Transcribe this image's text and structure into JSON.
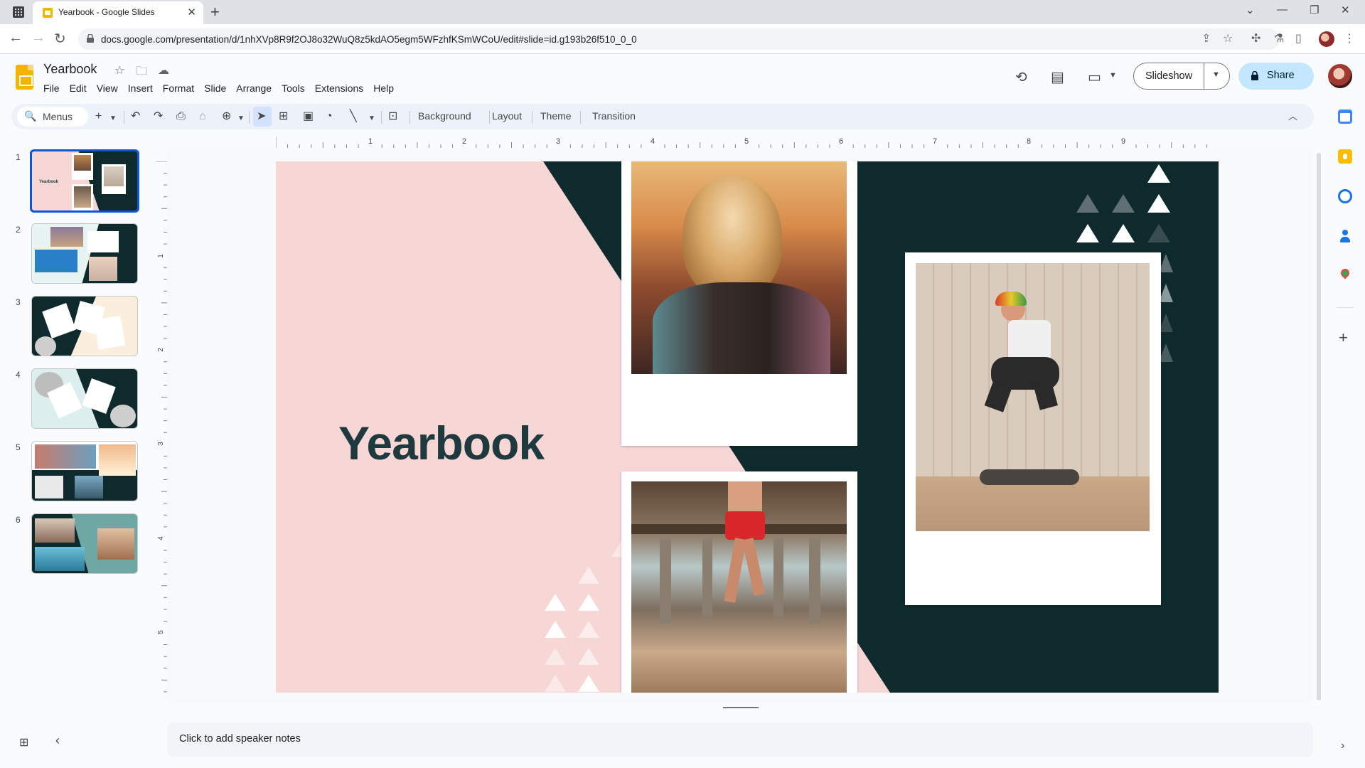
{
  "browser": {
    "tab_title": "Yearbook - Google Slides",
    "url": "docs.google.com/presentation/d/1nhXVp8R9f2OJ8o32WuQ8z5kdAO5egm5WFzhfKSmWCoU/edit#slide=id.g193b26f510_0_0"
  },
  "doc": {
    "title": "Yearbook",
    "menus": [
      "File",
      "Edit",
      "View",
      "Insert",
      "Format",
      "Slide",
      "Arrange",
      "Tools",
      "Extensions",
      "Help"
    ]
  },
  "header": {
    "slideshow_label": "Slideshow",
    "share_label": "Share"
  },
  "toolbar": {
    "search_label": "Menus",
    "background": "Background",
    "layout": "Layout",
    "theme": "Theme",
    "transition": "Transition"
  },
  "filmstrip": {
    "slides": [
      {
        "num": "1",
        "label": "Yearbook"
      },
      {
        "num": "2"
      },
      {
        "num": "3"
      },
      {
        "num": "4"
      },
      {
        "num": "5"
      },
      {
        "num": "6"
      }
    ]
  },
  "ruler": {
    "horizontal": [
      "1",
      "2",
      "3",
      "4",
      "5",
      "6",
      "7",
      "8",
      "9"
    ],
    "vertical": [
      "1",
      "2",
      "3",
      "4",
      "5"
    ]
  },
  "slide": {
    "title": "Yearbook"
  },
  "notes": {
    "placeholder": "Click to add speaker notes"
  },
  "colors": {
    "pink": "#f7d7d6",
    "dark": "#0f2a2c",
    "title": "#1e3a3f",
    "accent": "#0b57d0"
  }
}
